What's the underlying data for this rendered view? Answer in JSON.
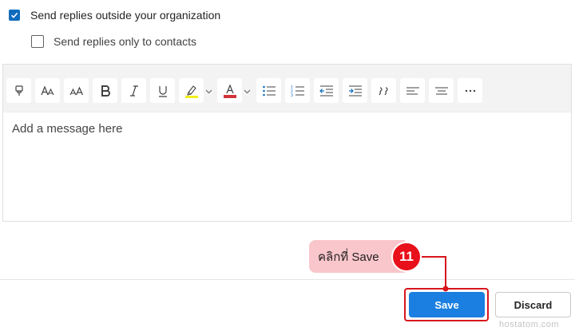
{
  "options": {
    "send_outside": {
      "label": "Send replies outside your organization",
      "checked": true
    },
    "only_contacts": {
      "label": "Send replies only to contacts",
      "checked": false
    }
  },
  "toolbar": {
    "buttons": [
      {
        "icon": "format-painter-icon"
      },
      {
        "icon": "font-icon"
      },
      {
        "icon": "font-size-icon"
      },
      {
        "icon": "bold-icon"
      },
      {
        "icon": "italic-icon"
      },
      {
        "icon": "underline-icon"
      },
      {
        "icon": "highlight-icon",
        "color": "#f2ef1b"
      },
      {
        "icon": "font-color-icon",
        "color": "#d13438"
      },
      {
        "icon": "bullets-icon"
      },
      {
        "icon": "numbering-icon"
      },
      {
        "icon": "decrease-indent-icon"
      },
      {
        "icon": "increase-indent-icon"
      },
      {
        "icon": "quote-icon"
      },
      {
        "icon": "align-left-icon"
      },
      {
        "icon": "align-center-icon"
      },
      {
        "icon": "more-options-icon"
      }
    ]
  },
  "editor": {
    "placeholder": "Add a message here"
  },
  "annotation": {
    "text": "คลิกที่ Save",
    "step": "11",
    "color": "#e8101a"
  },
  "buttons": {
    "save": "Save",
    "discard": "Discard"
  },
  "colors": {
    "accent": "#1a7fe0",
    "checkbox": "#0f6cbd"
  },
  "watermark": "hostatom.com"
}
